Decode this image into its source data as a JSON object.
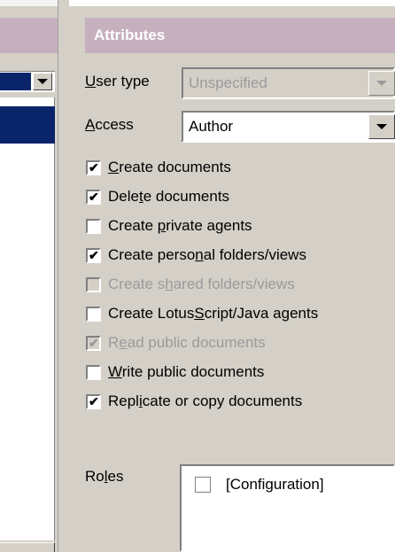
{
  "header": {
    "title": "Attributes"
  },
  "user_type": {
    "label": "User type",
    "value": "Unspecified",
    "enabled": false
  },
  "access": {
    "label": "Access",
    "value": "Author"
  },
  "permissions": [
    {
      "pre": "",
      "key": "C",
      "post": "reate documents",
      "checked": true,
      "enabled": true
    },
    {
      "pre": "Dele",
      "key": "t",
      "post": "e documents",
      "checked": true,
      "enabled": true
    },
    {
      "pre": "Create ",
      "key": "p",
      "post": "rivate agents",
      "checked": false,
      "enabled": true
    },
    {
      "pre": "Create perso",
      "key": "n",
      "post": "al folders/views",
      "checked": true,
      "enabled": true
    },
    {
      "pre": "Create s",
      "key": "h",
      "post": "ared folders/views",
      "checked": false,
      "enabled": false
    },
    {
      "pre": "Create Lotus",
      "key": "S",
      "post": "cript/Java agents",
      "checked": false,
      "enabled": true
    },
    {
      "pre": "R",
      "key": "e",
      "post": "ad public documents",
      "checked": true,
      "enabled": false
    },
    {
      "pre": "",
      "key": "W",
      "post": "rite public documents",
      "checked": false,
      "enabled": true
    },
    {
      "pre": "Repl",
      "key": "i",
      "post": "cate or copy documents",
      "checked": true,
      "enabled": true
    }
  ],
  "roles": {
    "label": "Roles",
    "items": [
      {
        "name": "[Configuration]",
        "checked": false
      }
    ]
  },
  "colors": {
    "header_bg": "#c6b0be",
    "panel_bg": "#d4d0c8",
    "selection": "#0a246a"
  }
}
